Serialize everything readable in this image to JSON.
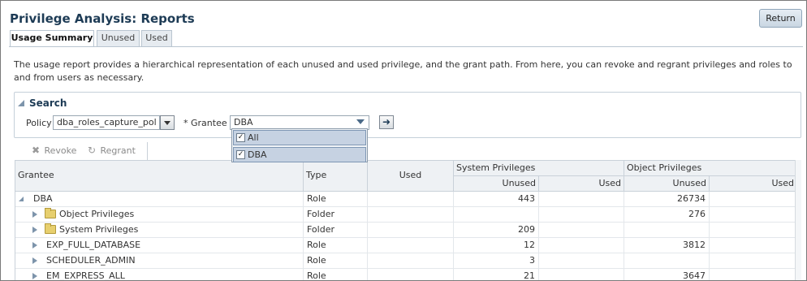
{
  "page": {
    "title": "Privilege Analysis: Reports",
    "return_label": "Return",
    "description": "The usage report provides a hierarchical representation of each unused and used privilege, and the grant path. From here, you can revoke and regrant privileges and roles to and from users as necessary."
  },
  "tabs": [
    {
      "label": "Usage Summary",
      "active": true
    },
    {
      "label": "Unused",
      "active": false
    },
    {
      "label": "Used",
      "active": false
    }
  ],
  "search": {
    "title": "Search",
    "policy_label": "Policy",
    "policy_value": "dba_roles_capture_pol",
    "grantee_required": "*",
    "grantee_label": "Grantee",
    "grantee_value": "DBA",
    "options": [
      {
        "label": "All",
        "checked": true
      },
      {
        "label": "DBA",
        "checked": true
      }
    ]
  },
  "toolbar": {
    "revoke_label": "Revoke",
    "regrant_label": "Regrant"
  },
  "table": {
    "headers": {
      "grantee": "Grantee",
      "type": "Type",
      "used": "Used",
      "system_privileges": "System Privileges",
      "object_privileges": "Object Privileges",
      "unused": "Unused",
      "used_sub": "Used"
    },
    "rows": [
      {
        "name": "DBA",
        "type": "Role",
        "used": "",
        "sys_unused": "443",
        "sys_used": "",
        "obj_unused": "26734",
        "obj_used": ""
      },
      {
        "name": "Object Privileges",
        "type": "Folder",
        "used": "",
        "sys_unused": "",
        "sys_used": "",
        "obj_unused": "276",
        "obj_used": ""
      },
      {
        "name": "System Privileges",
        "type": "Folder",
        "used": "",
        "sys_unused": "209",
        "sys_used": "",
        "obj_unused": "",
        "obj_used": ""
      },
      {
        "name": "EXP_FULL_DATABASE",
        "type": "Role",
        "used": "",
        "sys_unused": "12",
        "sys_used": "",
        "obj_unused": "3812",
        "obj_used": ""
      },
      {
        "name": "SCHEDULER_ADMIN",
        "type": "Role",
        "used": "",
        "sys_unused": "3",
        "sys_used": "",
        "obj_unused": "",
        "obj_used": ""
      },
      {
        "name": "EM_EXPRESS_ALL",
        "type": "Role",
        "used": "",
        "sys_unused": "21",
        "sys_used": "",
        "obj_unused": "3647",
        "obj_used": ""
      }
    ]
  },
  "icons": {
    "revoke": "x-icon",
    "regrant": "regrant-icon",
    "go": "arrow-right-icon",
    "folder": "folder-icon",
    "expand": "triangle-expand-icon"
  }
}
